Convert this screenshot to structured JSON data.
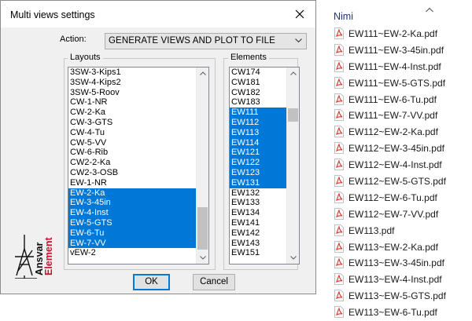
{
  "dialog": {
    "title": "Multi views settings",
    "action_label": "Action:",
    "action_value": "GENERATE VIEWS AND PLOT TO FILE",
    "layouts_label": "Layouts",
    "elements_label": "Elements",
    "ok_label": "OK",
    "cancel_label": "Cancel",
    "logo_text": "Ansvar Element",
    "layouts": [
      {
        "label": "3SW-3-Kips1",
        "selected": false
      },
      {
        "label": "3SW-4-Kips2",
        "selected": false
      },
      {
        "label": "3SW-5-Roov",
        "selected": false
      },
      {
        "label": "CW-1-NR",
        "selected": false
      },
      {
        "label": "CW-2-Ka",
        "selected": false
      },
      {
        "label": "CW-3-GTS",
        "selected": false
      },
      {
        "label": "CW-4-Tu",
        "selected": false
      },
      {
        "label": "CW-5-VV",
        "selected": false
      },
      {
        "label": "CW-6-Rib",
        "selected": false
      },
      {
        "label": "CW2-2-Ka",
        "selected": false
      },
      {
        "label": "CW2-3-OSB",
        "selected": false
      },
      {
        "label": "EW-1-NR",
        "selected": false
      },
      {
        "label": "EW-2-Ka",
        "selected": true
      },
      {
        "label": "EW-3-45in",
        "selected": true
      },
      {
        "label": "EW-4-Inst",
        "selected": true
      },
      {
        "label": "EW-5-GTS",
        "selected": true
      },
      {
        "label": "EW-6-Tu",
        "selected": true
      },
      {
        "label": "EW-7-VV",
        "selected": true
      },
      {
        "label": "vEW-2",
        "selected": false
      }
    ],
    "elements": [
      {
        "label": "CW174",
        "selected": false
      },
      {
        "label": "CW181",
        "selected": false
      },
      {
        "label": "CW182",
        "selected": false
      },
      {
        "label": "CW183",
        "selected": false
      },
      {
        "label": "EW111",
        "selected": true
      },
      {
        "label": "EW112",
        "selected": true
      },
      {
        "label": "EW113",
        "selected": true
      },
      {
        "label": "EW114",
        "selected": true
      },
      {
        "label": "EW121",
        "selected": true
      },
      {
        "label": "EW122",
        "selected": true
      },
      {
        "label": "EW123",
        "selected": true
      },
      {
        "label": "EW131",
        "selected": true
      },
      {
        "label": "EW132",
        "selected": false
      },
      {
        "label": "EW133",
        "selected": false
      },
      {
        "label": "EW134",
        "selected": false
      },
      {
        "label": "EW141",
        "selected": false
      },
      {
        "label": "EW142",
        "selected": false
      },
      {
        "label": "EW143",
        "selected": false
      },
      {
        "label": "EW151",
        "selected": false
      }
    ]
  },
  "explorer": {
    "header": "Nimi",
    "files": [
      "EW111~EW-2-Ka.pdf",
      "EW111~EW-3-45in.pdf",
      "EW111~EW-4-Inst.pdf",
      "EW111~EW-5-GTS.pdf",
      "EW111~EW-6-Tu.pdf",
      "EW111~EW-7-VV.pdf",
      "EW112~EW-2-Ka.pdf",
      "EW112~EW-3-45in.pdf",
      "EW112~EW-4-Inst.pdf",
      "EW112~EW-5-GTS.pdf",
      "EW112~EW-6-Tu.pdf",
      "EW112~EW-7-VV.pdf",
      "EW113.pdf",
      "EW113~EW-2-Ka.pdf",
      "EW113~EW-3-45in.pdf",
      "EW113~EW-4-Inst.pdf",
      "EW113~EW-5-GTS.pdf",
      "EW113~EW-6-Tu.pdf"
    ]
  },
  "colors": {
    "selection": "#0078d7",
    "pdf_icon": "#d8352a",
    "logo_accent": "#c8102e"
  }
}
